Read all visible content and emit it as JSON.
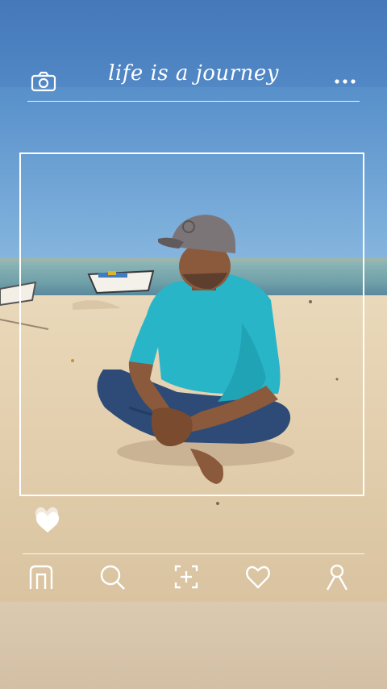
{
  "header": {
    "title": "life is a journey",
    "left_icon": "camera-icon",
    "right_icon": "more-dots-icon"
  },
  "reaction": {
    "icon": "heart-icon"
  },
  "bottom_nav": {
    "items": [
      {
        "icon": "home-icon"
      },
      {
        "icon": "search-icon"
      },
      {
        "icon": "add-post-icon"
      },
      {
        "icon": "heart-outline-icon"
      },
      {
        "icon": "profile-icon"
      }
    ]
  },
  "colors": {
    "frame": "#ffffff",
    "sky": "#5b93cc",
    "sand": "#e3cfae",
    "shirt": "#2ab6c9",
    "jeans": "#2c4a74"
  }
}
